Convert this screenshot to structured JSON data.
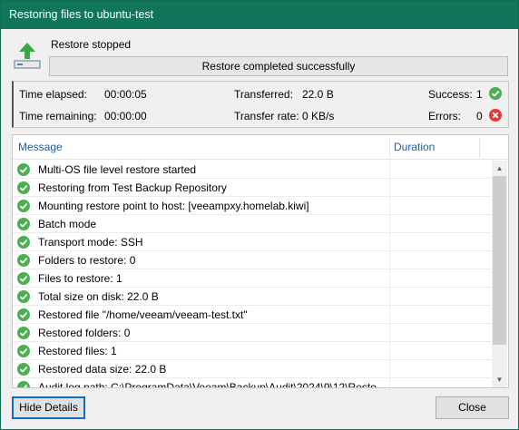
{
  "window": {
    "title": "Restoring files to ubuntu-test"
  },
  "status": {
    "text": "Restore stopped",
    "progress_text": "Restore completed successfully",
    "progress_fraction": 1.0
  },
  "stats": {
    "time_elapsed_label": "Time elapsed:",
    "time_elapsed_value": "00:00:05",
    "time_remaining_label": "Time remaining:",
    "time_remaining_value": "00:00:00",
    "transferred_label": "Transferred:",
    "transferred_value": "22.0 B",
    "transfer_rate_label": "Transfer rate:",
    "transfer_rate_value": "0 KB/s",
    "success_label": "Success:",
    "success_value": "1",
    "errors_label": "Errors:",
    "errors_value": "0"
  },
  "log": {
    "columns": {
      "message": "Message",
      "duration": "Duration"
    },
    "rows": [
      {
        "message": "Multi-OS file level restore started",
        "duration": ""
      },
      {
        "message": "Restoring from Test Backup Repository",
        "duration": ""
      },
      {
        "message": "Mounting restore point to host: [veeampxy.homelab.kiwi]",
        "duration": ""
      },
      {
        "message": "Batch mode",
        "duration": ""
      },
      {
        "message": "Transport mode: SSH",
        "duration": ""
      },
      {
        "message": "Folders to restore: 0",
        "duration": ""
      },
      {
        "message": "Files to restore: 1",
        "duration": ""
      },
      {
        "message": "Total size on disk: 22.0 B",
        "duration": ""
      },
      {
        "message": "Restored file \"/home/veeam/veeam-test.txt\"",
        "duration": ""
      },
      {
        "message": "Restored folders: 0",
        "duration": ""
      },
      {
        "message": "Restored files: 1",
        "duration": ""
      },
      {
        "message": "Restored data size: 22.0 B",
        "duration": ""
      },
      {
        "message": "Audit log path: C:\\ProgramData\\Veeam\\Backup\\Audit\\2024\\9\\12\\Resto",
        "duration": ""
      }
    ]
  },
  "buttons": {
    "hide_details": "Hide Details",
    "close": "Close"
  },
  "colors": {
    "titlebar": "#10755a",
    "success_green": "#4caf50",
    "error_red": "#e53935",
    "link_blue": "#1f5f9e"
  },
  "icons": {
    "restore": "restore-arrow-icon",
    "success": "check-circle-icon",
    "error": "x-circle-icon"
  }
}
